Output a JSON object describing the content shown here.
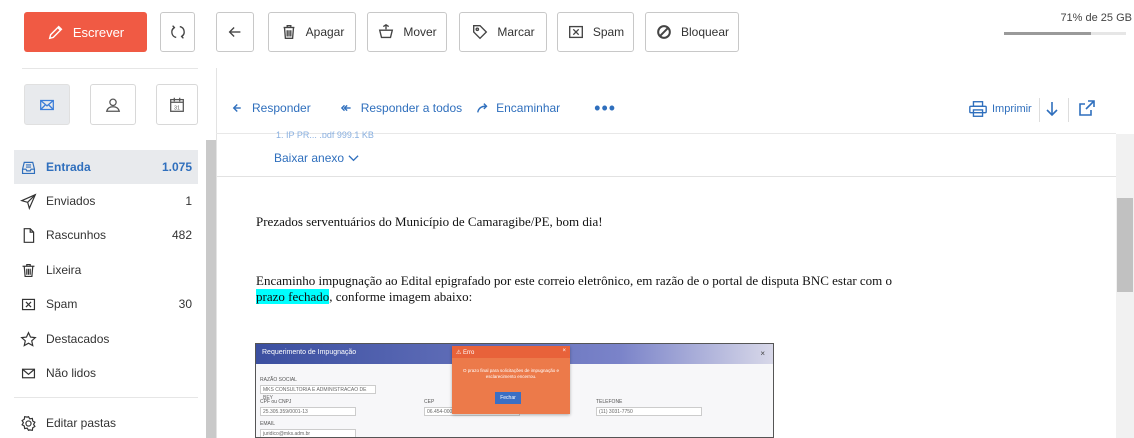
{
  "toolbar": {
    "compose_label": "Escrever",
    "back_title": "",
    "delete_label": "Apagar",
    "move_label": "Mover",
    "tag_label": "Marcar",
    "spam_label": "Spam",
    "block_label": "Bloquear"
  },
  "quota": {
    "text": "71% de 25 GB",
    "fraction": 0.71
  },
  "sidebar": {
    "views": [
      {
        "name": "mail",
        "icon": "mail-icon"
      },
      {
        "name": "contacts",
        "icon": "contact-icon"
      },
      {
        "name": "calendar",
        "icon": "calendar-icon",
        "day": "31"
      }
    ],
    "folders": [
      {
        "label": "Entrada",
        "count": "1.075",
        "icon": "inbox-icon",
        "active": true
      },
      {
        "label": "Enviados",
        "count": "1",
        "icon": "send-icon"
      },
      {
        "label": "Rascunhos",
        "count": "482",
        "icon": "draft-icon"
      },
      {
        "label": "Lixeira",
        "count": "",
        "icon": "trash-icon"
      },
      {
        "label": "Spam",
        "count": "30",
        "icon": "spam-icon"
      },
      {
        "label": "Destacados",
        "count": "",
        "icon": "star-icon"
      },
      {
        "label": "Não lidos",
        "count": "",
        "icon": "unread-icon"
      }
    ],
    "edit_folders": "Editar pastas"
  },
  "message": {
    "actions": {
      "reply": "Responder",
      "reply_all": "Responder a todos",
      "forward": "Encaminhar",
      "more": "•••",
      "print": "Imprimir"
    },
    "attachment_cut": "1. IP PR... .pdf  999.1 KB",
    "download_attachment": "Baixar anexo",
    "greeting": "Prezados serventuários do Município de Camaragibe/PE, bom dia!",
    "para1_line1": "Encaminho impugnação ao Edital epigrafado por este correio eletrônico, em razão de o portal de disputa BNC estar com o",
    "para1_highlight": "prazo fechado",
    "para1_rest": ", conforme imagem abaixo:"
  },
  "embedded_image": {
    "title": "Requerimento de Impugnação",
    "close": "×",
    "fields": {
      "razao_label": "RAZÃO SOCIAL",
      "razao_value": "MKS CONSULTORIA E ADMINISTRACAO DE BEY",
      "cpf_label": "CPF ou CNPJ",
      "cpf_value": "25.305.359/0001-13",
      "cep_label": "CEP",
      "cep_value": "06.454-000",
      "tel_label": "TELEFONE",
      "tel_value": "(11) 3031-7750",
      "email_label": "EMAIL",
      "email_value": "juridico@mks.adm.br"
    },
    "modal": {
      "title": "⚠ Erro",
      "close": "×",
      "body": "O prazo final para solicitações de impugnação e esclarecimento encerrou.",
      "button": "Fechar"
    }
  }
}
